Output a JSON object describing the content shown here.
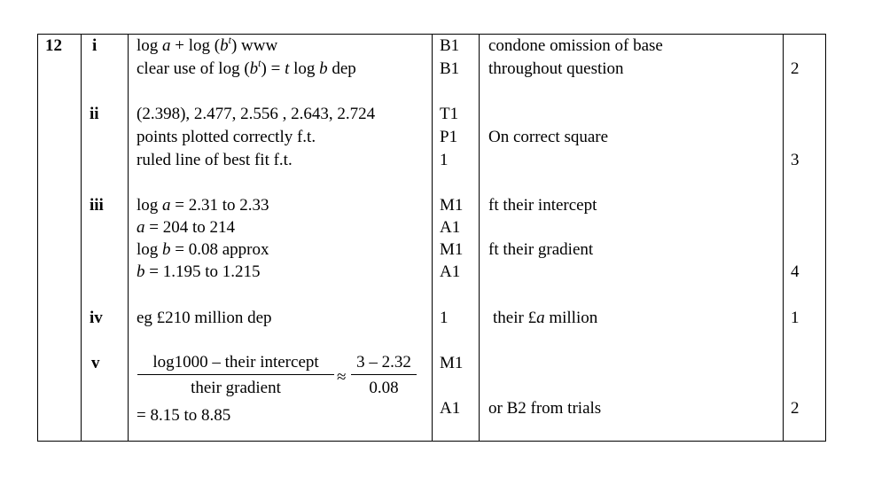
{
  "question": {
    "number": "12"
  },
  "parts": {
    "i": {
      "label": "i",
      "lines": [
        {
          "pre": "log ",
          "var1": "a",
          "mid": " + log (",
          "var2": "b",
          "sup": "t",
          "post": ")  www"
        },
        {
          "pre": "clear use of log (",
          "var1": "b",
          "sup": "t",
          "mid": ") = ",
          "var2": "t",
          "post": " log ",
          "var3": "b",
          "end": " dep"
        }
      ],
      "marks": [
        "B1",
        "B1"
      ],
      "notes": [
        "condone omission of base",
        "throughout question"
      ],
      "total": "2"
    },
    "ii": {
      "label": "ii",
      "lines": [
        "(2.398), 2.477, 2.556 , 2.643, 2.724",
        "points plotted correctly f.t.",
        "ruled line of best fit f.t."
      ],
      "marks": [
        "T1",
        "P1",
        "1"
      ],
      "notes": [
        "On correct square"
      ],
      "total": "3"
    },
    "iii": {
      "label": "iii",
      "lines": [
        {
          "pre": "log ",
          "var": "a",
          "post": " = 2.31 to 2.33"
        },
        {
          "pre": "",
          "var": "a",
          "post": " = 204 to 214"
        },
        {
          "pre": "log ",
          "var": "b",
          "post": " = 0.08 approx"
        },
        {
          "pre": "",
          "var": "b",
          "post": " = 1.195 to 1.215"
        }
      ],
      "marks": [
        "M1",
        "A1",
        "M1",
        "A1"
      ],
      "notes": [
        "ft their intercept",
        "ft their gradient"
      ],
      "total": "4"
    },
    "iv": {
      "label": "iv",
      "line": "eg £210 million dep",
      "mark": "1",
      "note_pre": "their £",
      "note_var": "a",
      "note_post": " million",
      "total": "1"
    },
    "v": {
      "label": "v",
      "frac1_num": "log1000 – their intercept",
      "frac1_den": "their gradient",
      "approx": "≈",
      "frac2_num": "3 – 2.32",
      "frac2_den": "0.08",
      "result": "= 8.15 to 8.85",
      "marks": [
        "M1",
        "A1"
      ],
      "notes": [
        "or B2 from trials"
      ],
      "total": "2"
    }
  }
}
